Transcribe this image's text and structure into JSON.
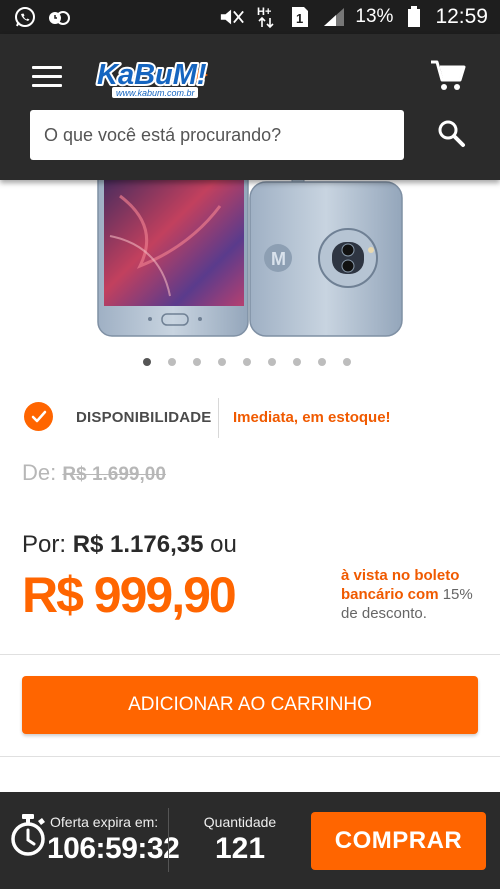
{
  "status_bar": {
    "battery": "13%",
    "time": "12:59",
    "icons": [
      "whatsapp-icon",
      "other-app-icon",
      "mute-icon",
      "data-icon",
      "sim-icon",
      "signal-icon",
      "battery-icon"
    ]
  },
  "header": {
    "logo_text": "KaBuM!",
    "logo_url_text": "www.kabum.com.br",
    "search_placeholder": "O que você está procurando?",
    "colors": {
      "bar": "#2b2b2b",
      "logo_blue": "#1565c0",
      "logo_orange": "#ff6500"
    }
  },
  "carousel": {
    "total": 9,
    "active_index": 0
  },
  "availability": {
    "label": "DISPONIBILIDADE",
    "value": "Imediata, em estoque!"
  },
  "pricing": {
    "old_prefix": "De:",
    "old_price": "R$ 1.699,00",
    "por_prefix": "Por:",
    "por_price": "R$ 1.176,35",
    "por_suffix": "ou",
    "main_price": "R$ 999,90",
    "note_highlight": "à vista no boleto bancário com",
    "note_rest": "15% de desconto."
  },
  "add_to_cart_label": "ADICIONAR AO CARRINHO",
  "bottom_bar": {
    "offer_label": "Oferta expira em:",
    "offer_time": "106:59:32",
    "qty_label": "Quantidade",
    "qty_value": "121",
    "buy_label": "COMPRAR"
  },
  "accent_color": "#ff6500"
}
